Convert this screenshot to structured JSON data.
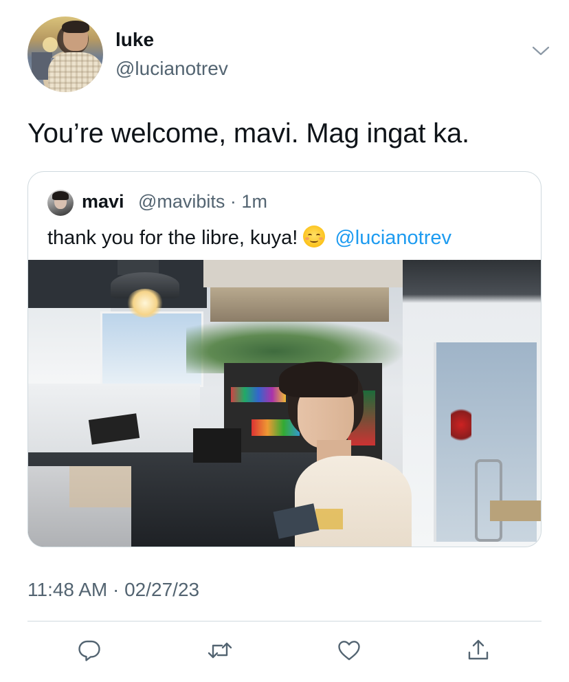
{
  "author": {
    "display_name": "luke",
    "handle": "@lucianotrev"
  },
  "tweet": {
    "text": "You’re welcome, mavi. Mag ingat ka.",
    "timestamp": "11:48 AM · 02/27/23"
  },
  "quoted_tweet": {
    "display_name": "mavi",
    "handle_time": "@mavibits · 1m",
    "text": "thank you for the libre, kuya!",
    "emoji": "smiling-face-with-blush",
    "mention": "@lucianotrev"
  },
  "actions": [
    "reply-icon",
    "retweet-icon",
    "like-icon",
    "share-icon"
  ],
  "colors": {
    "text_primary": "#0f1419",
    "text_secondary": "#536471",
    "link": "#1d9bf0",
    "border": "#cfd9de"
  }
}
